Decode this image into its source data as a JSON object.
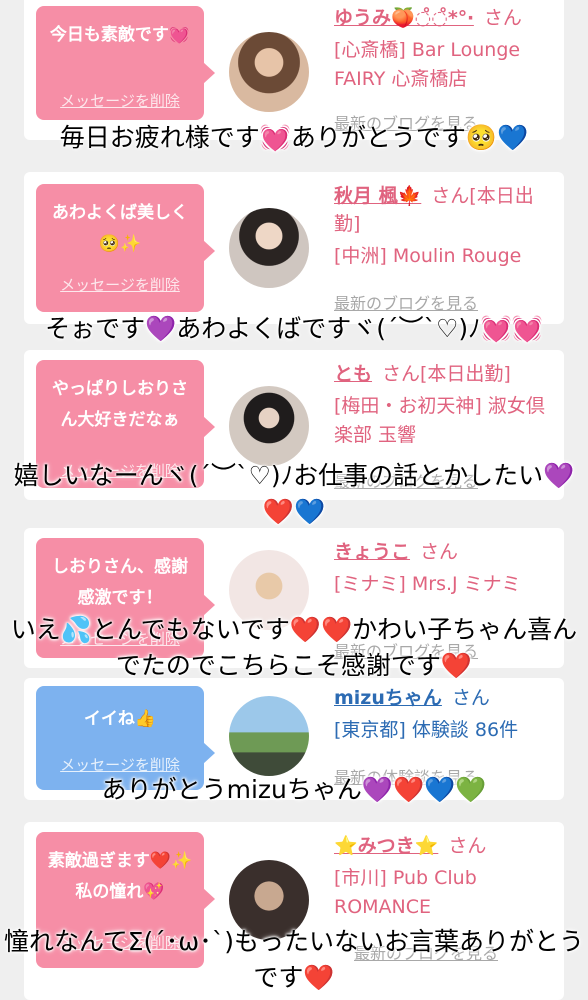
{
  "cards": [
    {
      "bubble_text": "今日も素敵です💓",
      "delete_label": "メッセージを削除",
      "name": "ゆうみ🍑◌̊◌̊*°‧",
      "honorific": "さん",
      "shop": "[心斎橋] Bar Lounge FAIRY 心斎橋店",
      "blog_label": "最新のブログを見る",
      "caption": "毎日お疲れ様です💓ありがとうです🥺💙"
    },
    {
      "bubble_text": "あわよくば美しく🥺✨",
      "delete_label": "メッセージを削除",
      "name": "秋月 楓🍁",
      "honorific": "さん[本日出勤]",
      "shop": "[中洲] Moulin Rouge",
      "blog_label": "最新のブログを見る",
      "caption": "そぉです💜あわよくばですヾ(´︶`♡)ﾉ💓💓"
    },
    {
      "bubble_text": "やっぱりしおりさん大好きだなぁ",
      "delete_label": "メッセージを削除",
      "name": "とも",
      "honorific": "さん[本日出勤]",
      "shop": "[梅田・お初天神] 淑女倶楽部 玉響",
      "blog_label": "最新のブログを見る",
      "caption": "嬉しいなーんヾ(´︶`♡)ﾉお仕事の話とかしたい💜❤️💙"
    },
    {
      "bubble_text": "しおりさん、感謝感激です！",
      "delete_label": "メッセージを削除",
      "name": "きょうこ",
      "honorific": "さん",
      "shop": "[ミナミ] Mrs.J ミナミ",
      "blog_label": "最新のブログを見る",
      "caption": "いえ💦とんでもないです❤️❤️かわい子ちゃん喜んでたのでこちらこそ感謝です❤️"
    },
    {
      "bubble_text": "イイね👍",
      "delete_label": "メッセージを削除",
      "name": "mizuちゃん",
      "honorific": "さん",
      "shop": "[東京都] 体験談 86件",
      "blog_label": "最新の体験談を見る",
      "caption": "ありがとうmizuちゃん💜❤️💙💚"
    },
    {
      "bubble_text": "素敵過ぎます❤️✨私の憧れ💖",
      "delete_label": "メッセージを削除",
      "name": "⭐️みつき⭐️",
      "honorific": "さん",
      "shop": "[市川] Pub Club ROMANCE",
      "blog_label": "最新のブログを見る",
      "caption": "憧れなんてΣ(´･ω･`)もったいないお言葉ありがとうです❤️"
    }
  ],
  "colors": {
    "accent_pink": "#f68ea6",
    "accent_blue": "#7db2ef",
    "name_pink": "#e0637f",
    "name_blue": "#2c6bb3"
  }
}
